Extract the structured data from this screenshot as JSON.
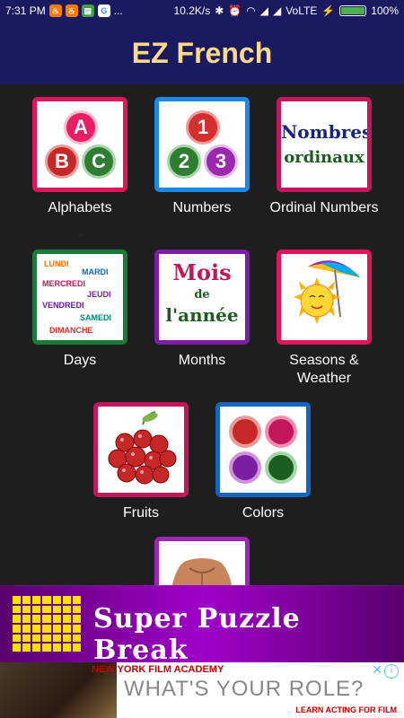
{
  "status_bar": {
    "time": "7:31 PM",
    "ellipsis": "...",
    "speed": "10.2K/s",
    "network": "VoLTE",
    "battery": "100%",
    "battery_level": 1.0
  },
  "app": {
    "title": "EZ French"
  },
  "tiles": [
    {
      "label": "Alphabets",
      "border": "#e0145a",
      "letters": [
        "A",
        "B",
        "C"
      ]
    },
    {
      "label": "Numbers",
      "border": "#1e88e5",
      "digits": [
        "1",
        "2",
        "3"
      ]
    },
    {
      "label": "Ordinal Numbers",
      "border": "#c2185b",
      "line1": "Nombres",
      "line2": "ordinaux"
    },
    {
      "label": "Days",
      "border": "#1b7a3a",
      "days": [
        "LUNDI",
        "MARDI",
        "MERCREDI",
        "JEUDI",
        "VENDREDI",
        "SAMEDI",
        "DIMANCHE"
      ]
    },
    {
      "label": "Months",
      "border": "#7b1fa2",
      "line1": "Mois",
      "line2": "de",
      "line3": "l'année"
    },
    {
      "label": "Seasons & Weather",
      "border": "#e0145a"
    },
    {
      "label": "Fruits",
      "border": "#c2185b"
    },
    {
      "label": "Colors",
      "border": "#1565c0"
    },
    {
      "label": "",
      "border": "#9c27b0"
    }
  ],
  "ads": {
    "banner_text": "Super Puzzle Break",
    "nyfa": "NEW YORK FILM ACADEMY",
    "role": "WHAT'S YOUR ROLE?",
    "learn": "LEARN ACTING FOR FILM"
  }
}
